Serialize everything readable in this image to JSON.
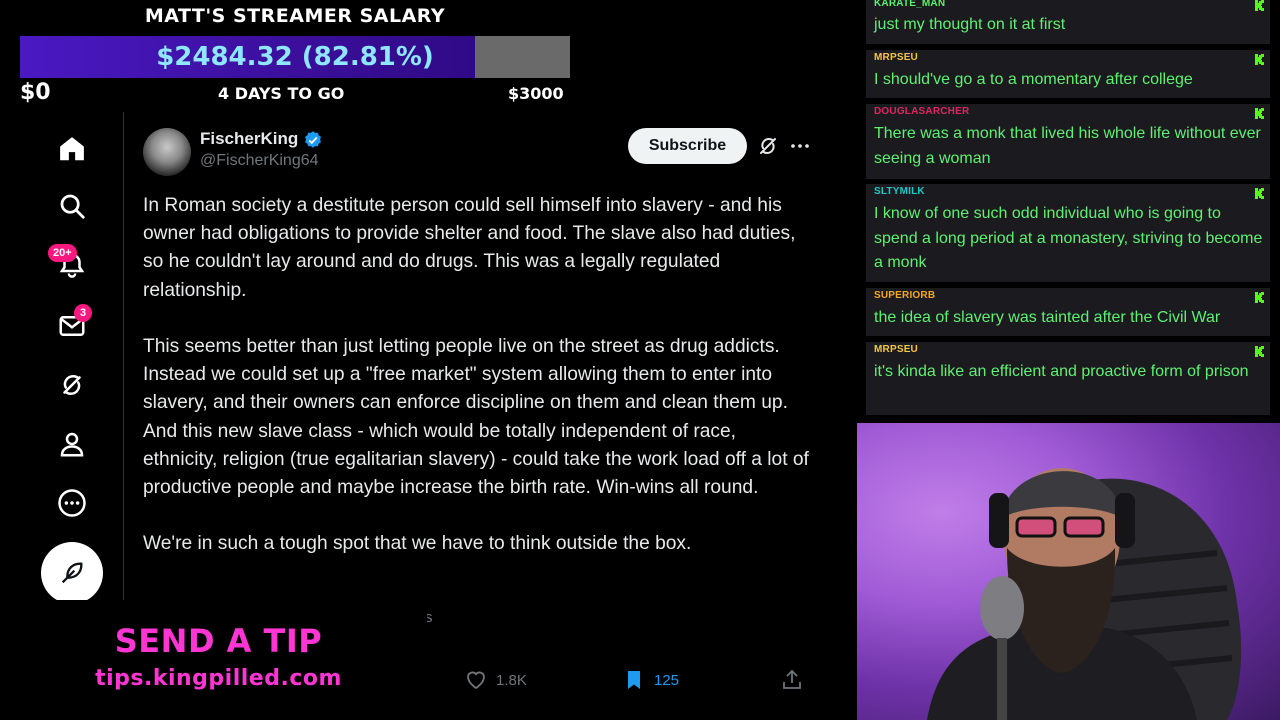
{
  "salary": {
    "title": "MATT'S STREAMER SALARY",
    "amount_label": "$2484.32 (82.81%)",
    "progress_fraction": 0.8281,
    "min_label": "$0",
    "days_label": "4 DAYS TO GO",
    "max_label": "$3000"
  },
  "nav": {
    "notifications_badge": "20+",
    "messages_badge": "3"
  },
  "tweet": {
    "display_name": "FischerKing",
    "handle": "@FischerKing64",
    "subscribe_label": "Subscribe",
    "paragraphs": [
      "In Roman society a destitute person could sell himself into slavery - and his owner had obligations to provide shelter and food. The slave also had duties, so he couldn't lay around and do drugs. This was a legally regulated relationship.",
      "This seems better than just letting people live on the street as drug addicts. Instead we could set up a \"free market\" system allowing them to enter into slavery, and their owners can enforce discipline on them and clean them up. And this new slave class - which would be totally independent of race, ethnicity, religion (true egalitarian slavery) - could take the work load off a lot of productive people and maybe increase the birth rate. Win-wins all round.",
      "We're in such a tough spot that we have to think outside the box."
    ],
    "meta_fragment": "s",
    "likes": "1.8K",
    "bookmarks": "125"
  },
  "tip": {
    "title": "SEND A TIP",
    "url": "tips.kingpilled.com"
  },
  "chat": {
    "messages": [
      {
        "user": "KARATE_MAN",
        "user_color": "#5ff072",
        "text": "just my thought on it at first"
      },
      {
        "user": "MRPSEU",
        "user_color": "#f5c542",
        "text": "I should've go a to a momentary after college"
      },
      {
        "user": "DOUGLASARCHER",
        "user_color": "#e0245e",
        "text": "There was a monk that lived his whole life without ever seeing a woman"
      },
      {
        "user": "SLTYMILK",
        "user_color": "#22c7c7",
        "text": "I know of one such odd individual who is going to spend a long period at a monastery, striving to become a monk"
      },
      {
        "user": "SUPERIORB",
        "user_color": "#f5a623",
        "text": "the idea of slavery was tainted after the Civil War"
      },
      {
        "user": "MRPSEU",
        "user_color": "#f5c542",
        "text": "it's kinda like an efficient and proactive form of prison"
      }
    ]
  },
  "colors": {
    "accent": "#1d9bf0",
    "chat_text": "#5ff072",
    "tip": "#ff35d3",
    "kick": "#53fc18"
  }
}
